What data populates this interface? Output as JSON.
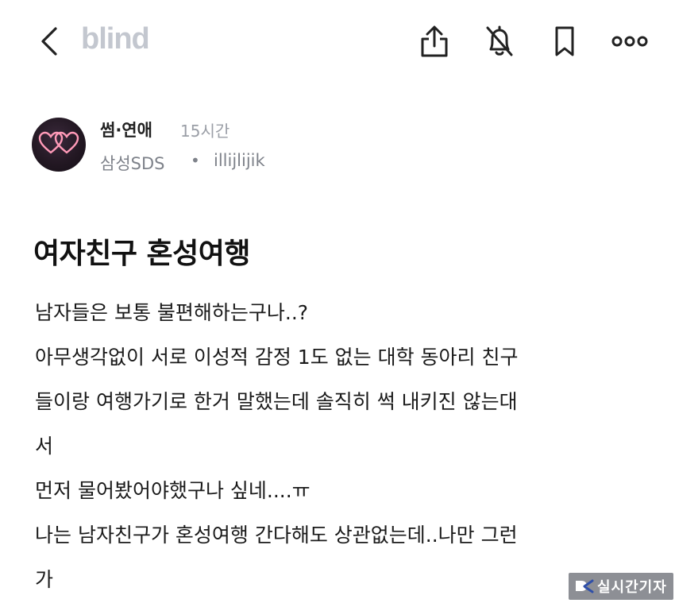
{
  "header": {
    "logo": "blind",
    "back_icon": "chevron-left-icon",
    "actions": [
      "share-icon",
      "notification-off-icon",
      "bookmark-icon",
      "more-icon"
    ]
  },
  "post": {
    "category": "썸·연애",
    "time": "15시간",
    "company": "삼성SDS",
    "separator": "•",
    "nickname": "illijlijik",
    "title": "여자친구 혼성여행",
    "body_lines": [
      "남자들은 보통 불편해하는구나..?",
      "아무생각없이 서로 이성적 감정 1도 없는 대학 동아리 친구",
      "들이랑 여행가기로 한거 말했는데 솔직히 썩 내키진 않는대",
      "서",
      "먼저 물어봤어야했구나 싶네....ㅠ",
      "나는 남자친구가 혼성여행 간다해도 상관없는데..나만 그런",
      "가"
    ]
  },
  "watermark": {
    "text": "실시간기자"
  },
  "colors": {
    "logo": "#c3c7cf",
    "meta": "#7e828a",
    "avatar_hearts": "#ff9ab8"
  }
}
